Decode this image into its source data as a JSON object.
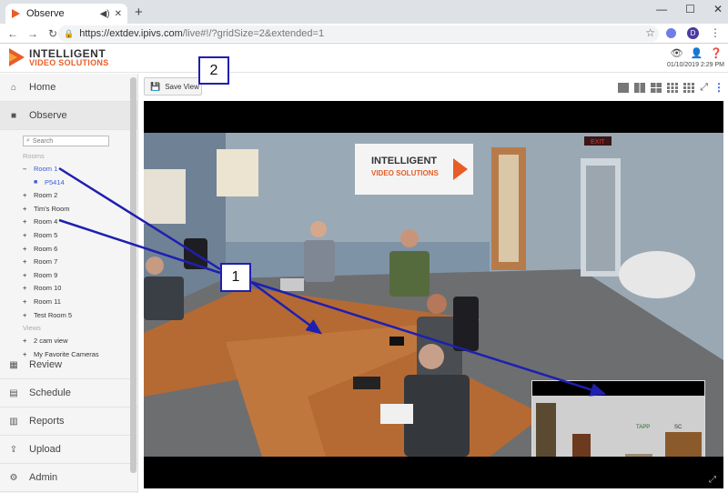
{
  "browser": {
    "tab_title": "Observe",
    "url_main": "https://extdev.ipivs.com",
    "url_rest": "/live#!/?gridSize=2&extended=1",
    "profile_initial": "D"
  },
  "app": {
    "logo_line1": "INTELLIGENT",
    "logo_line2": "VIDEO SOLUTIONS",
    "date": "01/10/2019 2:29 PM"
  },
  "nav": {
    "home": "Home",
    "observe": "Observe",
    "review": "Review",
    "schedule": "Schedule",
    "reports": "Reports",
    "upload": "Upload",
    "admin": "Admin"
  },
  "observe_panel": {
    "search_placeholder": "Search",
    "rooms_header": "Rooms",
    "rooms": [
      "Room 1",
      "P5414",
      "Room 2",
      "Tim's Room",
      "Room 4",
      "Room 5",
      "Room 6",
      "Room 7",
      "Room 9",
      "Room 10",
      "Room 11",
      "Test Room 5"
    ],
    "views_header": "Views",
    "views": [
      "2 cam view",
      "My Favorite Cameras"
    ]
  },
  "toolbar": {
    "save_view": "Save View"
  },
  "scene": {
    "sign_line1": "INTELLIGENT",
    "sign_line2": "VIDEO SOLUTIONS",
    "exit_sign": "EXIT",
    "pip_label1": "TAPP",
    "pip_label2": "SC"
  },
  "callouts": {
    "one": "1",
    "two": "2"
  },
  "colors": {
    "accent": "#3b5bdb",
    "callout": "#1f1fb0",
    "brand_orange": "#e85d27"
  }
}
